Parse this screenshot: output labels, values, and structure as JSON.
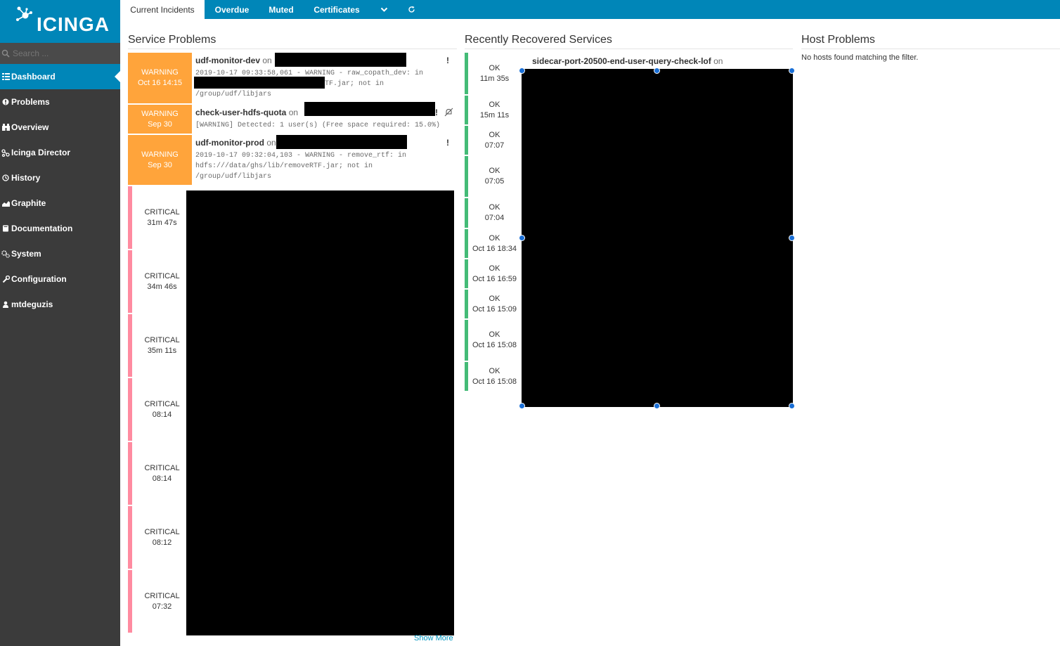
{
  "app": {
    "logo_text": "icinga",
    "brand_color": "#0086b8",
    "sidebar_color": "#3b3b3b"
  },
  "sidebar": {
    "search_placeholder": "Search ...",
    "items": [
      {
        "label": "Dashboard",
        "icon": "dashboard-grid-icon",
        "active": true
      },
      {
        "label": "Problems",
        "icon": "warning-circle-icon"
      },
      {
        "label": "Overview",
        "icon": "binoculars-icon"
      },
      {
        "label": "Icinga Director",
        "icon": "director-sitemap-icon"
      },
      {
        "label": "History",
        "icon": "history-icon"
      },
      {
        "label": "Graphite",
        "icon": "chart-area-icon"
      },
      {
        "label": "Documentation",
        "icon": "book-icon"
      },
      {
        "label": "System",
        "icon": "cogs-icon"
      },
      {
        "label": "Configuration",
        "icon": "wrench-icon"
      },
      {
        "label": "mtdeguzis",
        "icon": "user-icon"
      }
    ]
  },
  "tabs": [
    {
      "label": "Current Incidents",
      "active": true
    },
    {
      "label": "Overdue"
    },
    {
      "label": "Muted"
    },
    {
      "label": "Certificates"
    },
    {
      "label": "",
      "icon": "chevron-down-icon"
    },
    {
      "label": "",
      "icon": "refresh-icon"
    }
  ],
  "service_problems": {
    "title": "Service Problems",
    "warnings": [
      {
        "state": "WARNING",
        "time": "Oct 16 14:15",
        "service": "udf-monitor-dev",
        "on": "on",
        "flag": "!",
        "output": [
          "2019-10-17 09:33:58,061 - WARNING - raw_copath_dev: in",
          "TF.jar; not in",
          "/group/udf/libjars"
        ]
      },
      {
        "state": "WARNING",
        "time": "Sep 30",
        "service": "check-user-hdfs-quota",
        "on": "on",
        "flag": "!",
        "output": [
          "[WARNING] Detected: 1 user(s) (Free space required: 15.0%)"
        ]
      },
      {
        "state": "WARNING",
        "time": "Sep 30",
        "service": "udf-monitor-prod",
        "on": "on",
        "flag": "!",
        "output": [
          "2019-10-17 09:32:04,103 - WARNING - remove_rtf: in",
          "hdfs:///data/ghs/lib/removeRTF.jar; not in",
          "/group/udf/libjars"
        ]
      }
    ],
    "criticals": [
      {
        "state": "CRITICAL",
        "time": "31m 47s"
      },
      {
        "state": "CRITICAL",
        "time": "34m 46s"
      },
      {
        "state": "CRITICAL",
        "time": "35m 11s"
      },
      {
        "state": "CRITICAL",
        "time": "08:14"
      },
      {
        "state": "CRITICAL",
        "time": "08:14"
      },
      {
        "state": "CRITICAL",
        "time": "08:12"
      },
      {
        "state": "CRITICAL",
        "time": "07:32"
      }
    ],
    "show_more": "Show More"
  },
  "recovered": {
    "title": "Recently Recovered Services",
    "first_service": "sidecar-port-20500-end-user-query-check-lof",
    "on": "on",
    "rows": [
      {
        "state": "OK",
        "time": "11m 35s"
      },
      {
        "state": "OK",
        "time": "15m 11s"
      },
      {
        "state": "OK",
        "time": "07:07"
      },
      {
        "state": "OK",
        "time": "07:05"
      },
      {
        "state": "OK",
        "time": "07:04"
      },
      {
        "state": "OK",
        "time": "Oct 16 18:34"
      },
      {
        "state": "OK",
        "time": "Oct 16 16:59"
      },
      {
        "state": "OK",
        "time": "Oct 16 15:09"
      },
      {
        "state": "OK",
        "time": "Oct 16 15:08"
      },
      {
        "state": "OK",
        "time": "Oct 16 15:08"
      }
    ]
  },
  "host_problems": {
    "title": "Host Problems",
    "empty_text": "No hosts found matching the filter."
  }
}
